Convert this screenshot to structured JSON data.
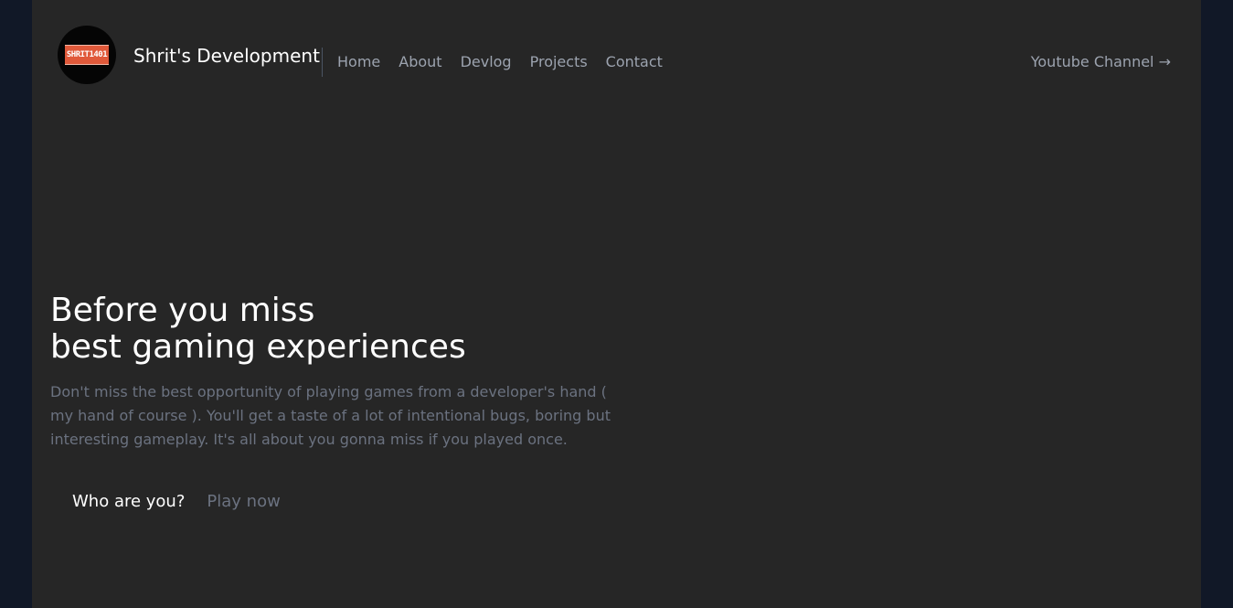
{
  "brand": {
    "logo_text": "SHRIT1401",
    "name": "Shrit's Development"
  },
  "nav": {
    "items": [
      "Home",
      "About",
      "Devlog",
      "Projects",
      "Contact"
    ],
    "youtube_label": "Youtube Channel →"
  },
  "hero": {
    "title_line1": "Before you miss",
    "title_line2": "best gaming experiences",
    "description": "Don't miss the best opportunity of playing games from a developer's hand ( my hand of course ). You'll get a taste of a lot of intentional bugs, boring but interesting gameplay. It's all about you gonna miss if you played once.",
    "primary_button": "Who are you?",
    "secondary_button": "Play now"
  },
  "colors": {
    "background_outer": "#111827",
    "background_page": "#262626",
    "accent_logo": "#e0593a"
  }
}
